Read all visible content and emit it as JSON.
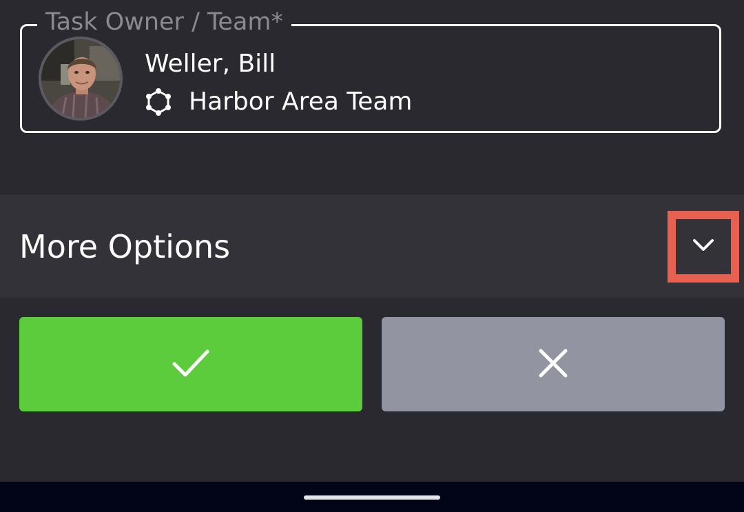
{
  "task_owner": {
    "legend": "Task Owner / Team*",
    "name": "Weller, Bill",
    "team": "Harbor Area Team",
    "avatar_icon": "user-photo",
    "team_icon": "team-network-icon"
  },
  "more_options": {
    "label": "More Options",
    "expand_icon": "chevron-down-icon",
    "highlight_color": "#e8604f"
  },
  "actions": {
    "confirm_icon": "check-icon",
    "cancel_icon": "close-icon",
    "confirm_color": "#5ccb3c",
    "cancel_color": "#9294a1"
  },
  "colors": {
    "background": "#2a292f",
    "panel": "#333238",
    "text": "#ffffff",
    "muted_text": "#8a8a90"
  }
}
